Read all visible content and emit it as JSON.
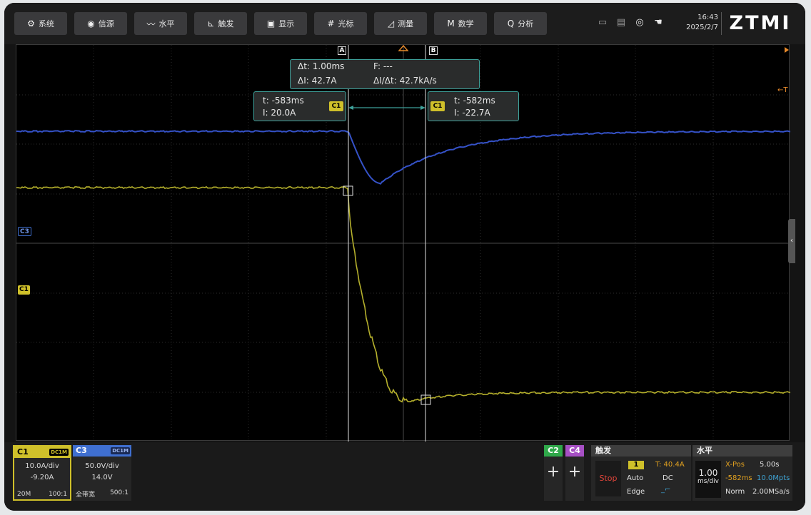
{
  "toolbar": {
    "buttons": [
      {
        "label": "系统",
        "icon": "gear-icon",
        "glyph": "⚙"
      },
      {
        "label": "信源",
        "icon": "signal-source-icon",
        "glyph": "◉"
      },
      {
        "label": "水平",
        "icon": "horizontal-wave-icon",
        "glyph": "〰"
      },
      {
        "label": "触发",
        "icon": "trigger-icon",
        "glyph": "⊾"
      },
      {
        "label": "显示",
        "icon": "display-icon",
        "glyph": "▣"
      },
      {
        "label": "光标",
        "icon": "cursor-icon",
        "glyph": "#"
      },
      {
        "label": "测量",
        "icon": "measure-icon",
        "glyph": "◿"
      },
      {
        "label": "数学",
        "icon": "math-icon",
        "glyph": "M"
      },
      {
        "label": "分析",
        "icon": "analyze-icon",
        "glyph": "Q"
      }
    ],
    "status_icons": [
      "screen-icon",
      "storage-icon",
      "network-icon",
      "touch-icon"
    ],
    "time": "16:43",
    "date": "2025/2/7",
    "logo": "ZTMI"
  },
  "cursors": {
    "a_label": "A",
    "b_label": "B",
    "delta_t": "Δt: 1.00ms",
    "freq": "F: ---",
    "delta_i": "ΔI: 42.7A",
    "slope": "ΔI/Δt: 42.7kA/s",
    "a_time": "t: -583ms",
    "a_value": "I: 20.0A",
    "b_time": "t: -582ms",
    "b_value": "I: -22.7A",
    "source": "C1"
  },
  "markers": {
    "c3": "C3",
    "c1": "C1",
    "trigger_level": "←T"
  },
  "channels": {
    "c1": {
      "name": "C1",
      "coupling": "DC1M",
      "scale": "10.0A/div",
      "offset": "-9.20A",
      "bw": "20M",
      "probe": "100:1",
      "color": "#cfc02a"
    },
    "c3": {
      "name": "C3",
      "coupling": "DC1M",
      "scale": "50.0V/div",
      "offset": "14.0V",
      "bw": "全带宽",
      "probe": "500:1",
      "color": "#3f6fd0"
    },
    "c2": {
      "name": "C2",
      "add": "+",
      "color": "#2fa84a"
    },
    "c4": {
      "name": "C4",
      "add": "+",
      "color": "#a64fc4"
    }
  },
  "trigger": {
    "title": "触发",
    "state": "Stop",
    "source": "1",
    "level": "T: 40.4A",
    "mode": "Auto",
    "coupling": "DC",
    "type": "Edge",
    "slope_glyph": "_⌐"
  },
  "horizontal": {
    "title": "水平",
    "scale_value": "1.00",
    "scale_unit": "ms/div",
    "xpos_label": "X-Pos",
    "xpos": "5.00s",
    "offset": "-582ms",
    "points": "10.0Mpts",
    "acq": "Norm",
    "rate": "2.00MSa/s"
  }
}
